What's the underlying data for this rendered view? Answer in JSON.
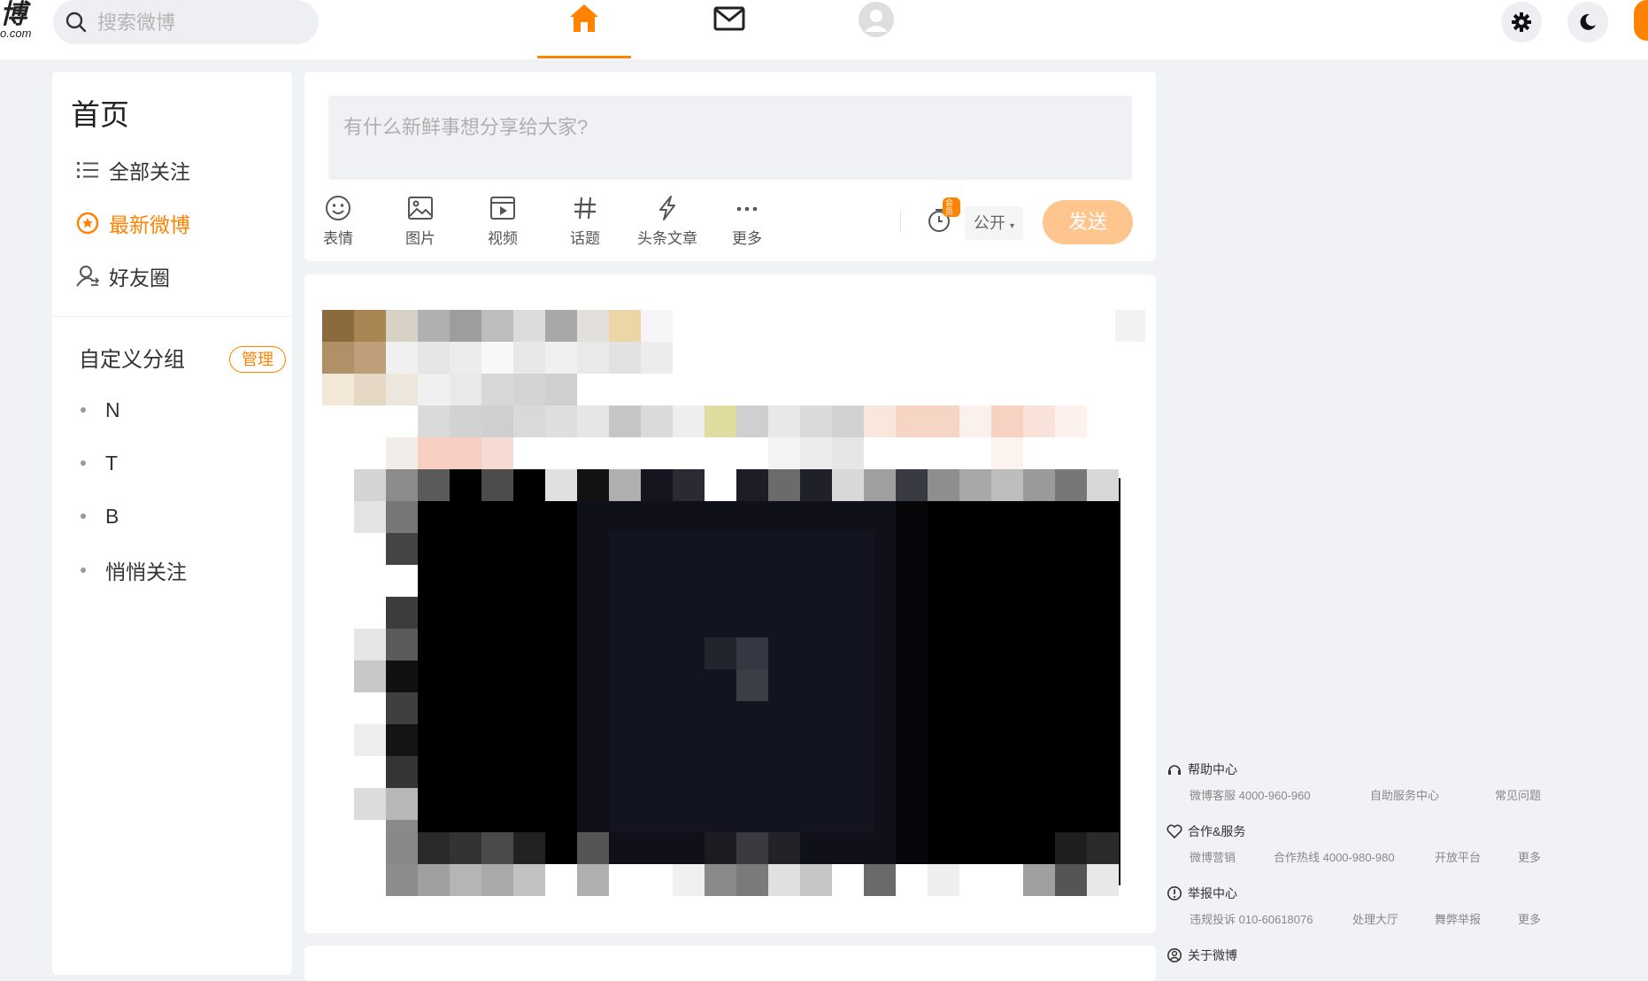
{
  "logo": {
    "line1": "博",
    "line2": "o.com"
  },
  "search": {
    "placeholder": "搜索微博"
  },
  "topnav": {
    "items": [
      {
        "name": "home",
        "icon": "home-icon",
        "active": true
      },
      {
        "name": "messages",
        "icon": "mail-icon",
        "active": false
      },
      {
        "name": "profile",
        "icon": "avatar-icon",
        "active": false
      }
    ],
    "right_icons": [
      "gear-icon",
      "moon-icon"
    ]
  },
  "sidebar": {
    "title": "首页",
    "items": [
      {
        "label": "全部关注",
        "icon": "list-icon",
        "active": false
      },
      {
        "label": "最新微博",
        "icon": "star-circle-icon",
        "active": true
      },
      {
        "label": "好友圈",
        "icon": "friends-icon",
        "active": false
      }
    ],
    "group_title": "自定义分组",
    "manage_label": "管理",
    "groups": [
      "N",
      "T",
      "B",
      "悄悄关注"
    ]
  },
  "composer": {
    "placeholder": "有什么新鲜事想分享给大家?",
    "tools": [
      {
        "label": "表情",
        "icon": "emoji-icon"
      },
      {
        "label": "图片",
        "icon": "image-icon"
      },
      {
        "label": "视频",
        "icon": "video-icon"
      },
      {
        "label": "话题",
        "icon": "hashtag-icon"
      },
      {
        "label": "头条文章",
        "icon": "lightning-icon"
      },
      {
        "label": "更多",
        "icon": "more-icon"
      }
    ],
    "vip_badge": "会员",
    "visibility": "公开",
    "send_label": "发送"
  },
  "colors": {
    "accent": "#ff8200",
    "send_disabled": "#ffc58f",
    "page_bg": "#f1f2f5"
  },
  "footer": {
    "sections": [
      {
        "title": "帮助中心",
        "icon": "headset-icon",
        "links": [
          "微博客服 4000-960-960",
          "自助服务中心",
          "常见问题"
        ]
      },
      {
        "title": "合作&服务",
        "icon": "handshake-icon",
        "links": [
          "微博营销",
          "合作热线 4000-980-980",
          "开放平台",
          "更多"
        ]
      },
      {
        "title": "举报中心",
        "icon": "alert-icon",
        "links": [
          "违规投诉 010-60618076",
          "处理大厅",
          "舞弊举报",
          "更多"
        ]
      },
      {
        "title": "关于微博",
        "icon": "about-icon",
        "links": []
      }
    ]
  }
}
